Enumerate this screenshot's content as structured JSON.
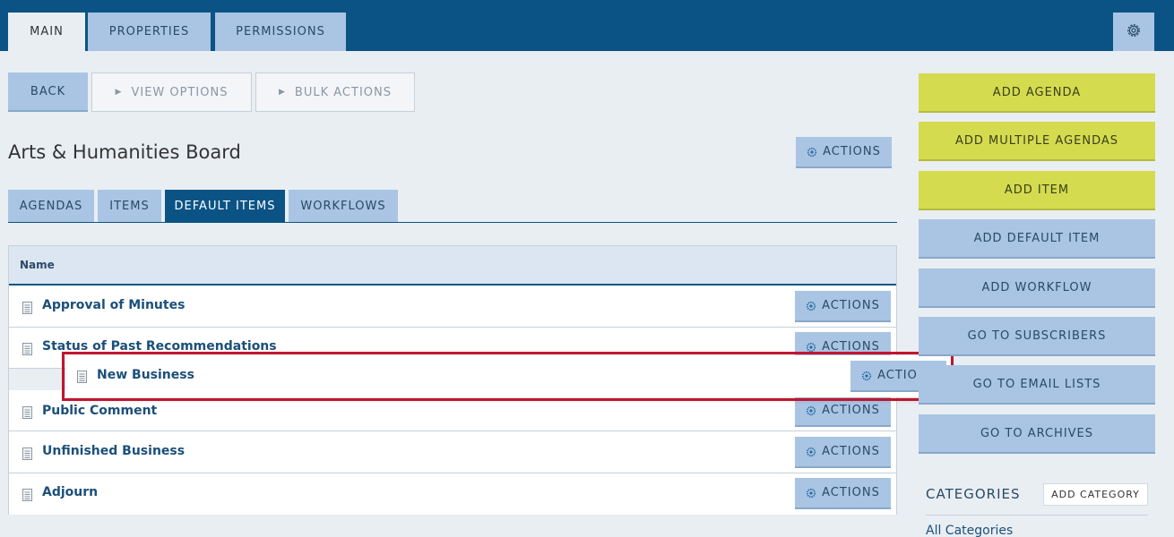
{
  "top_tabs": [
    "MAIN",
    "PROPERTIES",
    "PERMISSIONS"
  ],
  "settings_icon": "gear-icon",
  "toolbar": {
    "back": "BACK",
    "view_options": "VIEW OPTIONS",
    "bulk_actions": "BULK ACTIONS"
  },
  "board": {
    "title": "Arts & Humanities Board",
    "actions": "ACTIONS"
  },
  "sub_tabs": [
    "AGENDAS",
    "ITEMS",
    "DEFAULT ITEMS",
    "WORKFLOWS"
  ],
  "active_sub_tab": "DEFAULT ITEMS",
  "table": {
    "header": "Name",
    "action_label": "ACTIONS",
    "rows": [
      "Approval of Minutes",
      "Status of Past Recommendations",
      "Public Comment",
      "Unfinished Business",
      "Adjourn"
    ],
    "dragging_row": "New Business"
  },
  "right_actions": {
    "add_agenda": "ADD AGENDA",
    "add_multiple_agendas": "ADD MULTIPLE AGENDAS",
    "add_item": "ADD ITEM",
    "add_default_item": "ADD DEFAULT ITEM",
    "add_workflow": "ADD WORKFLOW",
    "go_to_subscribers": "GO TO SUBSCRIBERS",
    "go_to_email_lists": "GO TO EMAIL LISTS",
    "go_to_archives": "GO TO ARCHIVES"
  },
  "categories": {
    "heading": "CATEGORIES",
    "add": "ADD CATEGORY",
    "all": "All Categories"
  },
  "colors": {
    "header_blue": "#0b5385",
    "button_blue": "#a9c5e3",
    "button_yellow": "#d5db4e",
    "highlight_red": "#c2152f"
  }
}
